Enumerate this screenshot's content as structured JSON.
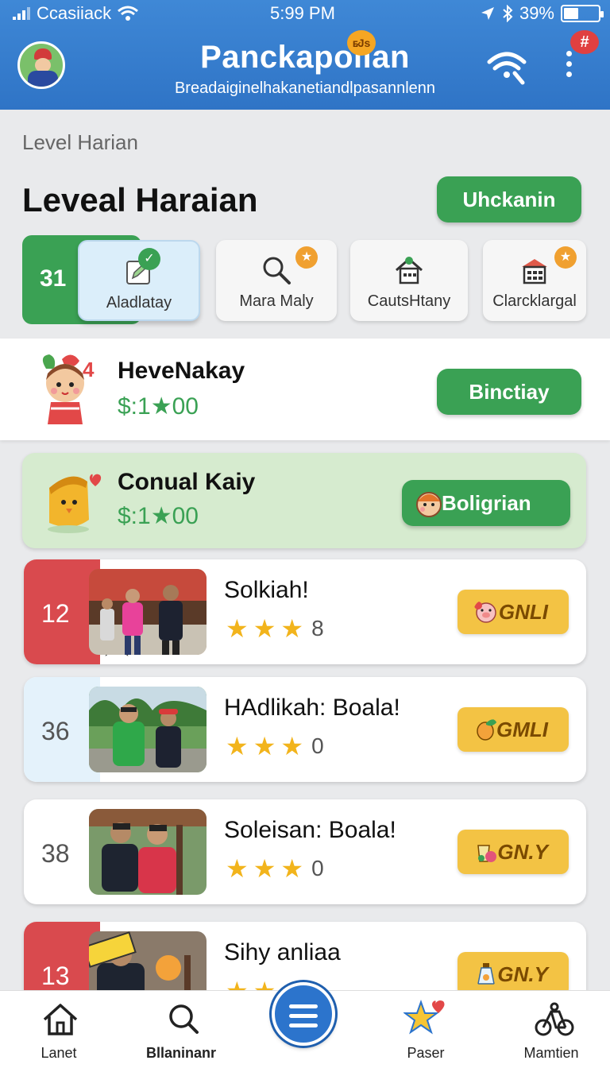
{
  "status_bar": {
    "carrier": "Ccasiiack",
    "time": "5:99 PM",
    "battery": "39%",
    "battery_level": 0.39
  },
  "header": {
    "title": "Panckapolian",
    "subtitle": "Breadaiginelhakanetiandlpasannlenn",
    "title_badge": "ᴇ̷Js",
    "notification_badge": "#"
  },
  "section": {
    "breadcrumb": "Level Harian",
    "title": "Leveal Haraian",
    "unlock_button": "Uhckanin"
  },
  "level_badge": "31",
  "categories": [
    {
      "label": "Aladlatay",
      "icon": "edit-icon",
      "active": true
    },
    {
      "label": "Mara Maly",
      "icon": "search-icon",
      "active": false
    },
    {
      "label": "CautsHtany",
      "icon": "house-icon",
      "active": false
    },
    {
      "label": "Clarcklargal",
      "icon": "building-icon",
      "active": false
    }
  ],
  "featured": [
    {
      "name": "HeveNakay",
      "price": "$:1★00",
      "button": "Binctiay",
      "corner": "4"
    },
    {
      "name": "Conual Kaiy",
      "price": "$:1★00",
      "button": "Boligrian"
    }
  ],
  "list": [
    {
      "num": "12",
      "name": "Solkiah!",
      "stars": "★",
      "count": "8",
      "button": "GNLI",
      "style": "red"
    },
    {
      "num": "36",
      "name": "HAdlikah: Boala!",
      "stars": "★",
      "count": "0",
      "button": "GMLI",
      "style": "blue"
    },
    {
      "num": "38",
      "name": "Soleisan: Boala!",
      "stars": "★",
      "count": "0",
      "button": "GN.Y",
      "style": "plain"
    },
    {
      "num": "13",
      "name": "Sihy anliaa",
      "stars": "★",
      "count": "",
      "button": "GN.Y",
      "style": "red"
    }
  ],
  "nav": {
    "home": "Lanet",
    "search": "Bllaninanr",
    "favorites": "Paser",
    "profile": "Mamtien"
  },
  "colors": {
    "primary": "#2f74c6",
    "green": "#3aa154",
    "red": "#d94a4e",
    "gold": "#f3c344"
  }
}
